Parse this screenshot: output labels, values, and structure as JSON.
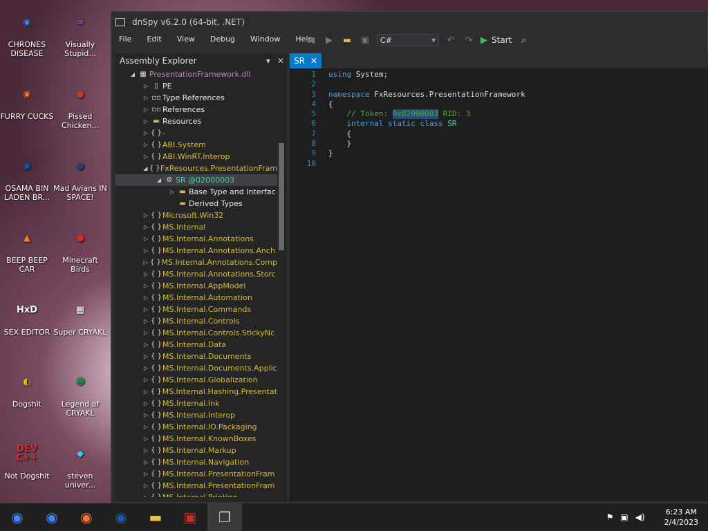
{
  "desktop": [
    {
      "label": "CHRONES DISEASE",
      "icon": "chrome-icon",
      "glyph": "◉",
      "color": "#4285f4"
    },
    {
      "label": "Visually Stupid...",
      "icon": "visual-studio-icon",
      "glyph": "∞",
      "color": "#8661c5"
    },
    {
      "label": "FURRY CUCKS",
      "icon": "firefox-icon",
      "glyph": "◉",
      "color": "#ff7139"
    },
    {
      "label": "Pissed Chicken...",
      "icon": "angry-birds-seasons-icon",
      "glyph": "●",
      "color": "#c0392b"
    },
    {
      "label": "OSAMA BIN LADEN BR...",
      "icon": "obama-logo-icon",
      "glyph": "◉",
      "color": "#1a5ba6"
    },
    {
      "label": "Mad Avians IN SPACE!",
      "icon": "angry-birds-space-icon",
      "glyph": "●",
      "color": "#2c3e70"
    },
    {
      "label": "BEEP BEEP CAR",
      "icon": "vlc-cone-icon",
      "glyph": "▲",
      "color": "#f18a00"
    },
    {
      "label": "Minecraft Birds",
      "icon": "angry-birds-icon",
      "glyph": "●",
      "color": "#d62d20"
    },
    {
      "label": "SEX EDITOR",
      "icon": "hxd-icon",
      "glyph": "HxD",
      "color": "#ffffff"
    },
    {
      "label": "Super CRYAKL",
      "icon": "pixel-cat-icon",
      "glyph": "▦",
      "color": "#ffffff"
    },
    {
      "label": "Dogshit",
      "icon": "codeblocks-icon",
      "glyph": "◐",
      "color": "#e0c000"
    },
    {
      "label": "Legend of CRYAKL",
      "icon": "pixel-hero-icon",
      "glyph": "☻",
      "color": "#2e8b57"
    },
    {
      "label": "Not Dogshit",
      "icon": "devcpp-icon",
      "glyph": "DEV C++",
      "color": "#d32f2f"
    },
    {
      "label": "steven univer...",
      "icon": "gem-icon",
      "glyph": "◆",
      "color": "#40c4ff"
    }
  ],
  "window": {
    "title": "dnSpy v6.2.0 (64-bit, .NET)"
  },
  "menu": [
    "File",
    "Edit",
    "View",
    "Debug",
    "Window",
    "Help"
  ],
  "toolbar": {
    "language": "C#",
    "start": "Start"
  },
  "explorer": {
    "title": "Assembly Explorer",
    "rows": [
      {
        "indent": 1,
        "tw": "◢",
        "icon": "▦",
        "text": "PresentationFramework.dll",
        "kind": "asm"
      },
      {
        "indent": 2,
        "tw": "▷",
        "icon": "▯",
        "text": "PE",
        "kind": "plain"
      },
      {
        "indent": 2,
        "tw": "▷",
        "icon": "▫▫",
        "text": "Type References",
        "kind": "plain"
      },
      {
        "indent": 2,
        "tw": "▷",
        "icon": "▫▫",
        "text": "References",
        "kind": "plain"
      },
      {
        "indent": 2,
        "tw": "▷",
        "icon": "▬",
        "text": "Resources",
        "kind": "folder"
      },
      {
        "indent": 2,
        "tw": "▷",
        "icon": "{ }",
        "text": "-",
        "kind": "ns"
      },
      {
        "indent": 2,
        "tw": "▷",
        "icon": "{ }",
        "text": "ABI.System",
        "kind": "ns"
      },
      {
        "indent": 2,
        "tw": "▷",
        "icon": "{ }",
        "text": "ABI.WinRT.Interop",
        "kind": "ns"
      },
      {
        "indent": 2,
        "tw": "◢",
        "icon": "{ }",
        "text": "FxResources.PresentationFram",
        "kind": "ns"
      },
      {
        "indent": 3,
        "tw": "◢",
        "icon": "⚙",
        "text": "SR @02000003",
        "kind": "sel"
      },
      {
        "indent": 4,
        "tw": "▷",
        "icon": "▬",
        "text": "Base Type and Interfac",
        "kind": "folder"
      },
      {
        "indent": 4,
        "tw": "",
        "icon": "▬",
        "text": "Derived Types",
        "kind": "folder"
      },
      {
        "indent": 2,
        "tw": "▷",
        "icon": "{ }",
        "text": "Microsoft.Win32",
        "kind": "ns"
      },
      {
        "indent": 2,
        "tw": "▷",
        "icon": "{ }",
        "text": "MS.Internal",
        "kind": "ns"
      },
      {
        "indent": 2,
        "tw": "▷",
        "icon": "{ }",
        "text": "MS.Internal.Annotations",
        "kind": "ns"
      },
      {
        "indent": 2,
        "tw": "▷",
        "icon": "{ }",
        "text": "MS.Internal.Annotations.Anch",
        "kind": "ns"
      },
      {
        "indent": 2,
        "tw": "▷",
        "icon": "{ }",
        "text": "MS.Internal.Annotations.Comp",
        "kind": "ns"
      },
      {
        "indent": 2,
        "tw": "▷",
        "icon": "{ }",
        "text": "MS.Internal.Annotations.Storc",
        "kind": "ns"
      },
      {
        "indent": 2,
        "tw": "▷",
        "icon": "{ }",
        "text": "MS.Internal.AppModel",
        "kind": "ns"
      },
      {
        "indent": 2,
        "tw": "▷",
        "icon": "{ }",
        "text": "MS.Internal.Automation",
        "kind": "ns"
      },
      {
        "indent": 2,
        "tw": "▷",
        "icon": "{ }",
        "text": "MS.Internal.Commands",
        "kind": "ns"
      },
      {
        "indent": 2,
        "tw": "▷",
        "icon": "{ }",
        "text": "MS.Internal.Controls",
        "kind": "ns"
      },
      {
        "indent": 2,
        "tw": "▷",
        "icon": "{ }",
        "text": "MS.Internal.Controls.StickyNc",
        "kind": "ns"
      },
      {
        "indent": 2,
        "tw": "▷",
        "icon": "{ }",
        "text": "MS.Internal.Data",
        "kind": "ns"
      },
      {
        "indent": 2,
        "tw": "▷",
        "icon": "{ }",
        "text": "MS.Internal.Documents",
        "kind": "ns"
      },
      {
        "indent": 2,
        "tw": "▷",
        "icon": "{ }",
        "text": "MS.Internal.Documents.Applic",
        "kind": "ns"
      },
      {
        "indent": 2,
        "tw": "▷",
        "icon": "{ }",
        "text": "MS.Internal.Globalization",
        "kind": "ns"
      },
      {
        "indent": 2,
        "tw": "▷",
        "icon": "{ }",
        "text": "MS.Internal.Hashing.Presentat",
        "kind": "ns"
      },
      {
        "indent": 2,
        "tw": "▷",
        "icon": "{ }",
        "text": "MS.Internal.Ink",
        "kind": "ns"
      },
      {
        "indent": 2,
        "tw": "▷",
        "icon": "{ }",
        "text": "MS.Internal.Interop",
        "kind": "ns"
      },
      {
        "indent": 2,
        "tw": "▷",
        "icon": "{ }",
        "text": "MS.Internal.IO.Packaging",
        "kind": "ns"
      },
      {
        "indent": 2,
        "tw": "▷",
        "icon": "{ }",
        "text": "MS.Internal.KnownBoxes",
        "kind": "ns"
      },
      {
        "indent": 2,
        "tw": "▷",
        "icon": "{ }",
        "text": "MS.Internal.Markup",
        "kind": "ns"
      },
      {
        "indent": 2,
        "tw": "▷",
        "icon": "{ }",
        "text": "MS.Internal.Navigation",
        "kind": "ns"
      },
      {
        "indent": 2,
        "tw": "▷",
        "icon": "{ }",
        "text": "MS.Internal.PresentationFram",
        "kind": "ns"
      },
      {
        "indent": 2,
        "tw": "▷",
        "icon": "{ }",
        "text": "MS.Internal.PresentationFram",
        "kind": "ns"
      },
      {
        "indent": 2,
        "tw": "▷",
        "icon": "{ }",
        "text": "MS.Internal.Printing",
        "kind": "ns"
      }
    ]
  },
  "editor": {
    "tab": "SR",
    "lines": [
      {
        "n": "1",
        "parts": [
          [
            "kw",
            "using "
          ],
          [
            "txt",
            "System;"
          ]
        ]
      },
      {
        "n": "2",
        "parts": []
      },
      {
        "n": "3",
        "parts": [
          [
            "kw",
            "namespace "
          ],
          [
            "txt",
            "FxResources.PresentationFramework"
          ]
        ]
      },
      {
        "n": "4",
        "parts": [
          [
            "txt",
            "{"
          ]
        ]
      },
      {
        "n": "5",
        "parts": [
          [
            "cm",
            "    // Token: "
          ],
          [
            "hl",
            "0x02000003"
          ],
          [
            "cm",
            " RID: 3"
          ]
        ]
      },
      {
        "n": "6",
        "parts": [
          [
            "kw",
            "    internal static class "
          ],
          [
            "tp",
            "SR"
          ]
        ]
      },
      {
        "n": "7",
        "parts": [
          [
            "txt",
            "    {"
          ]
        ]
      },
      {
        "n": "8",
        "parts": [
          [
            "txt",
            "    }"
          ]
        ]
      },
      {
        "n": "9",
        "parts": [
          [
            "txt",
            "}"
          ]
        ]
      },
      {
        "n": "10",
        "parts": []
      }
    ]
  },
  "taskbar": {
    "time": "6:23 AM",
    "date": "2/4/2023"
  }
}
